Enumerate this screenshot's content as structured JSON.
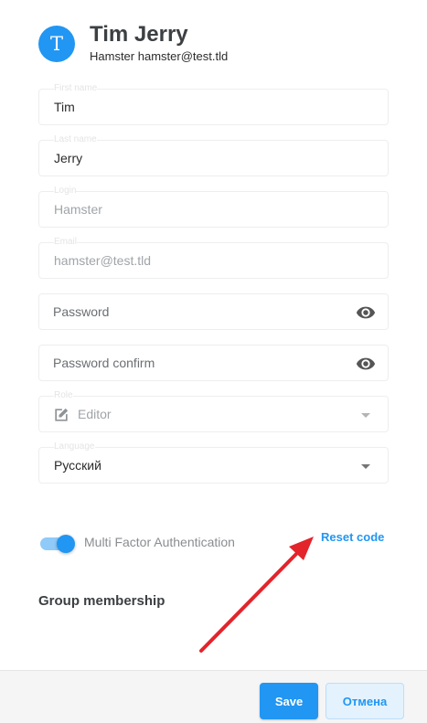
{
  "header": {
    "avatar_letter": "T",
    "name": "Tim Jerry",
    "subtitle": "Hamster hamster@test.tld"
  },
  "form": {
    "first_name": {
      "label": "First name",
      "value": "Tim"
    },
    "last_name": {
      "label": "Last name",
      "value": "Jerry"
    },
    "login": {
      "label": "Login",
      "value": "Hamster"
    },
    "email": {
      "label": "Email",
      "value": "hamster@test.tld"
    },
    "password": {
      "placeholder": "Password"
    },
    "password_confirm": {
      "placeholder": "Password confirm"
    },
    "role": {
      "label": "Role",
      "value": "Editor"
    },
    "language": {
      "label": "Language",
      "value": "Русский"
    }
  },
  "mfa": {
    "label": "Multi Factor Authentication",
    "enabled": true,
    "reset_label": "Reset code"
  },
  "group_membership": {
    "title": "Group membership"
  },
  "footer": {
    "save_label": "Save",
    "cancel_label": "Отмена"
  },
  "colors": {
    "accent": "#2196f3",
    "annotation_arrow": "#e3242b"
  }
}
